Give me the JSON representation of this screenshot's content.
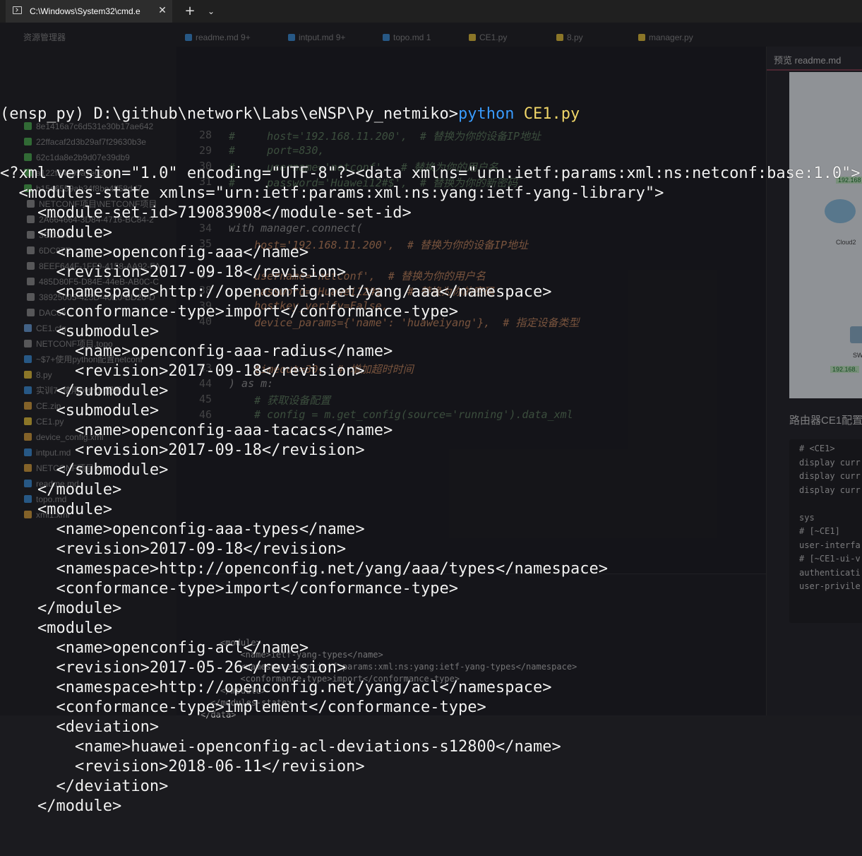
{
  "terminal": {
    "tab_title": "C:\\Windows\\System32\\cmd.e",
    "close_glyph": "✕",
    "new_tab_glyph": "+",
    "dropdown_glyph": "⌄",
    "prompt": "(ensp_py) D:\\github\\network\\Labs\\eNSP\\Py_netmiko>",
    "command": "python",
    "argument": "CE1.py",
    "output_lines": [
      "<?xml version=\"1.0\" encoding=\"UTF-8\"?><data xmlns=\"urn:ietf:params:xml:ns:netconf:base:1.0\">",
      "  <modules-state xmlns=\"urn:ietf:params:xml:ns:yang:ietf-yang-library\">",
      "    <module-set-id>719083908</module-set-id>",
      "    <module>",
      "      <name>openconfig-aaa</name>",
      "      <revision>2017-09-18</revision>",
      "      <namespace>http://openconfig.net/yang/aaa</namespace>",
      "      <conformance-type>import</conformance-type>",
      "      <submodule>",
      "        <name>openconfig-aaa-radius</name>",
      "        <revision>2017-09-18</revision>",
      "      </submodule>",
      "      <submodule>",
      "        <name>openconfig-aaa-tacacs</name>",
      "        <revision>2017-09-18</revision>",
      "      </submodule>",
      "    </module>",
      "    <module>",
      "      <name>openconfig-aaa-types</name>",
      "      <revision>2017-09-18</revision>",
      "      <namespace>http://openconfig.net/yang/aaa/types</namespace>",
      "      <conformance-type>import</conformance-type>",
      "    </module>",
      "    <module>",
      "      <name>openconfig-acl</name>",
      "      <revision>2017-05-26</revision>",
      "      <namespace>http://openconfig.net/yang/acl</namespace>",
      "      <conformance-type>implement</conformance-type>",
      "      <deviation>",
      "        <name>huawei-openconfig-acl-deviations-s12800</name>",
      "        <revision>2018-06-11</revision>",
      "      </deviation>",
      "    </module>"
    ]
  },
  "background": {
    "editor_tabs": [
      {
        "label": "资源管理器",
        "color": "#00000000"
      },
      {
        "label": "readme.md 9+",
        "color": "#3b8fd9"
      },
      {
        "label": "intput.md 9+",
        "color": "#3b8fd9"
      },
      {
        "label": "topo.md 1",
        "color": "#3b8fd9"
      },
      {
        "label": "CE1.py",
        "color": "#e7c33a"
      },
      {
        "label": "8.py",
        "color": "#e7c33a"
      },
      {
        "label": "manager.py",
        "color": "#e7c33a"
      }
    ],
    "sidebar_items": [
      {
        "label": "8e1416a7c6d531e30b17ae642",
        "color": "#4caf50"
      },
      {
        "label": "22ffacaf2d3b29af7f29630b3e",
        "color": "#4caf50"
      },
      {
        "label": "62c1da8e2b9d07e39db9",
        "color": "#4caf50"
      },
      {
        "label": "a122f84e99a7e03c47",
        "color": "#4caf50"
      },
      {
        "label": "b15e6559ab34f8be4ff58dd7",
        "color": "#4caf50"
      },
      {
        "label": "NETCONF项目\\NETCONF项目",
        "color": "#8d8d8d"
      },
      {
        "label": "2A664664-3D84-4716-BC84-2",
        "color": "#8d8d8d"
      },
      {
        "label": "3CD19C",
        "color": "#8d8d8d"
      },
      {
        "label": "6DC97E",
        "color": "#8d8d8d"
      },
      {
        "label": "8EEF644F-1FF9-4158-AA92-FA",
        "color": "#8d8d8d"
      },
      {
        "label": "485D80F5-D84E-44eB-AB0C-C",
        "color": "#8d8d8d"
      },
      {
        "label": "38925005-423D-40E0-BD20-D",
        "color": "#8d8d8d"
      },
      {
        "label": "DAC66",
        "color": "#8d8d8d"
      },
      {
        "label": "CE1.cfg",
        "color": "#6a9fd9"
      },
      {
        "label": "NETCONF项目.topo",
        "color": "#8d8d8d"
      },
      {
        "label": "~$7+使用python配置netconf",
        "color": "#3b8fd9"
      },
      {
        "label": "8.py",
        "color": "#e7c33a"
      },
      {
        "label": "实训7+使用python配置",
        "color": "#3b8fd9"
      },
      {
        "label": "CE.zip",
        "color": "#d9a13b"
      },
      {
        "label": "CE1.py",
        "color": "#e7c33a"
      },
      {
        "label": "device_config.xml",
        "color": "#d9a13b"
      },
      {
        "label": "intput.md",
        "color": "#3b8fd9"
      },
      {
        "label": "NETCONF项目.zip",
        "color": "#d9a13b"
      },
      {
        "label": "readme.md",
        "color": "#3b8fd9"
      },
      {
        "label": "topo.md",
        "color": "#3b8fd9"
      },
      {
        "label": "xml1.xml",
        "color": "#d9a13b"
      }
    ],
    "code_lines": [
      {
        "ln": "28",
        "text": "#     host='192.168.11.200',  # 替换为你的设备IP地址",
        "color": "#5d7d5d"
      },
      {
        "ln": "29",
        "text": "#     port=830,",
        "color": "#5d7d5d"
      },
      {
        "ln": "30",
        "text": "#     username='netconf',  # 替换为你的用户名",
        "color": "#5d7d5d"
      },
      {
        "ln": "31",
        "text": "#     password='Huawei12#$',  # 替换为你的新密码",
        "color": "#5d7d5d"
      },
      {
        "ln": "34",
        "text": "with manager.connect(",
        "color": "#9a9a9a"
      },
      {
        "ln": "35",
        "text": "    host='192.168.11.200',  # 替换为你的设备IP地址",
        "color": "#c7875e"
      },
      {
        "ln": "37",
        "text": "    username='netconf',  # 替换为你的用户名",
        "color": "#c7875e"
      },
      {
        "ln": "38",
        "text": "    password='Huawei12#$',  # 替换为你的密码",
        "color": "#c7875e"
      },
      {
        "ln": "39",
        "text": "    hostkey_verify=False,",
        "color": "#c7875e"
      },
      {
        "ln": "40",
        "text": "    device_params={'name': 'huaweiyang'},  # 指定设备类型",
        "color": "#c7875e"
      },
      {
        "ln": "43",
        "text": "    timeout=30,  # 增加超时时间",
        "color": "#c7875e"
      },
      {
        "ln": "44",
        "text": ") as m:",
        "color": "#9a9a9a"
      },
      {
        "ln": "45",
        "text": "    # 获取设备配置",
        "color": "#5d7d5d"
      },
      {
        "ln": "46",
        "text": "    # config = m.get_config(source='running').data_xml",
        "color": "#5d7d5d"
      }
    ],
    "preview_tab": "预览 readme.md",
    "preview_heading": "路由器CE1配置",
    "topo_cloud_label": "Cloud2",
    "topo_sw_label": "SW",
    "topo_ip_1": "192.168",
    "topo_ip_2": "192.168.",
    "snippet_lines": [
      "# <CE1>",
      "display curr",
      "display curr",
      "display curr",
      "",
      "sys",
      "# [~CE1]",
      "user-interfa",
      "# [~CE1-ui-v",
      "authenticati",
      "user-privile"
    ],
    "bottom_xml": [
      "<module>",
      "  <name>ietf-yang-types</name>",
      "  <namespace>urn:ietf:params:xml:ns:yang:ietf-yang-types</namespace>",
      "  <conformance-type>import</conformance-type>",
      "</module>",
      "</modules-state>",
      "</data>"
    ]
  }
}
